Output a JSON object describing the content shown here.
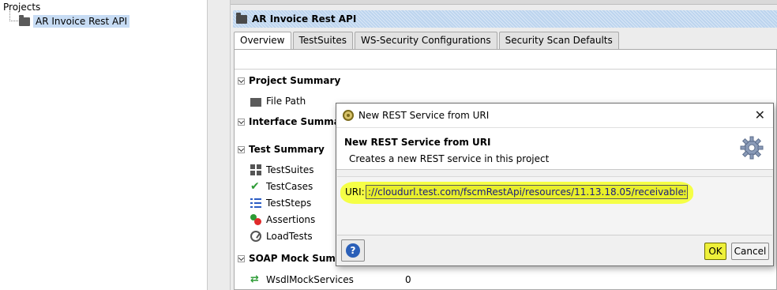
{
  "tree": {
    "root_label": "Projects",
    "project_label": "AR Invoice Rest API"
  },
  "editor": {
    "title": "AR Invoice Rest API",
    "tabs": [
      {
        "label": "Overview",
        "active": true
      },
      {
        "label": "TestSuites",
        "active": false
      },
      {
        "label": "WS-Security Configurations",
        "active": false
      },
      {
        "label": "Security Scan Defaults",
        "active": false
      }
    ],
    "sections": {
      "project_summary": {
        "title": "Project Summary",
        "file_path_label": "File Path"
      },
      "interface_summary": {
        "title": "Interface Summary"
      },
      "test_summary": {
        "title": "Test Summary",
        "items": [
          {
            "label": "TestSuites",
            "icon": "grid-icon"
          },
          {
            "label": "TestCases",
            "icon": "check-icon"
          },
          {
            "label": "TestSteps",
            "icon": "steps-icon"
          },
          {
            "label": "Assertions",
            "icon": "assertions-icon"
          },
          {
            "label": "LoadTests",
            "icon": "gauge-icon"
          }
        ]
      },
      "soap_mock_summary": {
        "title": "SOAP Mock Summa",
        "items": [
          {
            "label": "WsdlMockServices",
            "value": "0",
            "icon": "mock-services-icon"
          }
        ]
      }
    }
  },
  "dialog": {
    "window_title": "New REST Service from URI",
    "header_title": "New REST Service from URI",
    "header_description": "Creates a new REST service in this project",
    "uri_label": "URI:",
    "uri_value": "://cloudurl.test.com/fscmRestApi/resources/11.13.18.05/receivablesInvoices",
    "ok_label": "OK",
    "cancel_label": "Cancel",
    "help_label": "?",
    "close_label": "✕",
    "highlight_color": "#f4ff3c"
  }
}
